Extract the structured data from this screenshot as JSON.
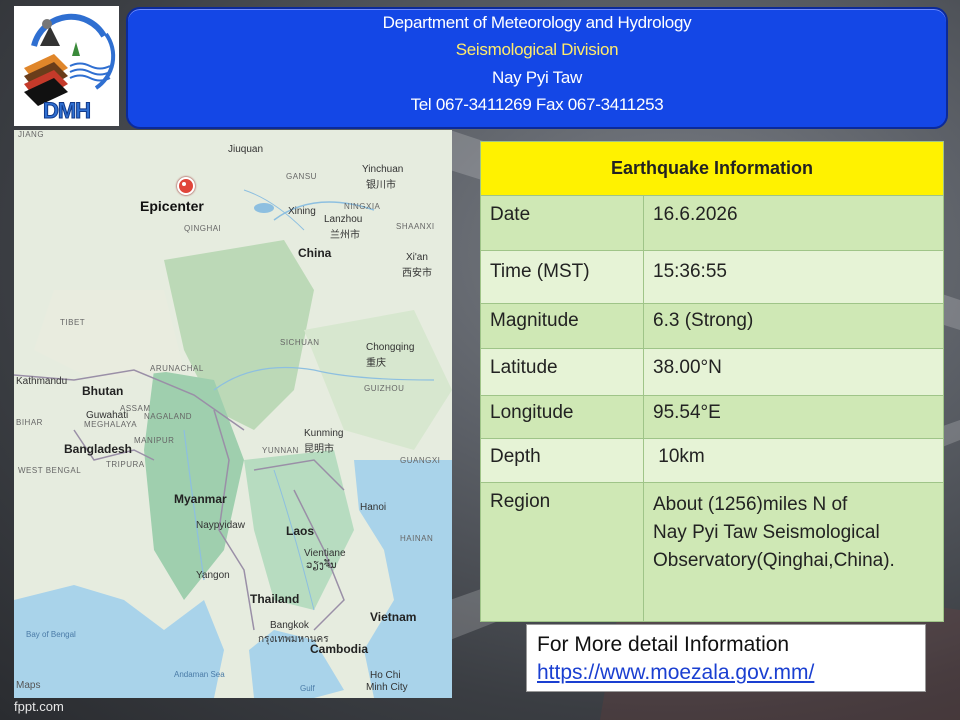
{
  "logo": {
    "text": "DMH"
  },
  "header": {
    "line1": "Department of Meteorology and Hydrology",
    "line2": "Seismological Division",
    "line3": "Nay Pyi Taw",
    "line4": "Tel 067-3411269 Fax 067-3411253"
  },
  "map": {
    "epicenter_label": "Epicenter",
    "labels": {
      "jiang": "JIANG",
      "juquan": "Jiuquan",
      "yinchuan": "Yinchuan",
      "yinchuan_cn": "银川市",
      "gansu": "GANSU",
      "ningxia": "NINGXIA",
      "xining": "Xining",
      "lanzhou": "Lanzhou",
      "lanzhou_cn": "兰州市",
      "qinghai": "QINGHAI",
      "shaanxi": "SHAANXI",
      "china": "China",
      "xian": "Xi'an",
      "xian_cn": "西安市",
      "tibet": "TIBET",
      "sichuan": "SICHUAN",
      "chongqing": "Chongqing",
      "chongqing_cn": "重庆",
      "kathmandu": "Kathmandu",
      "arunachal": "ARUNACHAL",
      "bhutan": "Bhutan",
      "guizhou": "GUIZHOU",
      "assam": "ASSAM",
      "guwahati": "Guwahati",
      "nagaland": "NAGALAND",
      "meghalaya": "MEGHALAYA",
      "bihar": "BIHAR",
      "manipur": "MANIPUR",
      "kunming": "Kunming",
      "kunming_cn": "昆明市",
      "yunnan": "YUNNAN",
      "guangxi": "GUANGXI",
      "bangladesh": "Bangladesh",
      "tripura": "TRIPURA",
      "west_bengal": "WEST BENGAL",
      "myanmar": "Myanmar",
      "hanoi": "Hanoi",
      "naypyidaw": "Naypyidaw",
      "laos": "Laos",
      "hainan": "HAINAN",
      "vientiane": "Vientiane",
      "vientiane_local": "ວຽງຈັນ",
      "yangon": "Yangon",
      "thailand": "Thailand",
      "bay_of_bengal": "Bay of Bengal",
      "vietnam": "Vietnam",
      "bangkok": "Bangkok",
      "bangkok_th": "กรุงเทพมหานคร",
      "cambodia": "Cambodia",
      "andaman": "Andaman Sea",
      "gulf": "Gulf",
      "ho_chi_minh": "Ho Chi",
      "ho_chi_minh2": "Minh City",
      "maps": "Maps"
    }
  },
  "info": {
    "title": "Earthquake Information",
    "rows": [
      {
        "label": "Date",
        "value": "16.6.2026"
      },
      {
        "label": "Time (MST)",
        "value": "15:36:55"
      },
      {
        "label": "Magnitude",
        "value": "6.3 (Strong)"
      },
      {
        "label": "Latitude",
        "value": "38.00°N"
      },
      {
        "label": "Longitude",
        "value": "95.54°E"
      },
      {
        "label": "Depth",
        "value": " 10km"
      }
    ],
    "region_label": "Region",
    "region_lines": [
      "About (1256)miles N of",
      "Nay Pyi Taw Seismological",
      "Observatory(Qinghai,China)."
    ]
  },
  "detail": {
    "line1": "For More detail Information",
    "link": "https://www.moezala.gov.mm/"
  },
  "watermark": "fppt.com",
  "colors": {
    "header_bg": "#1447e6",
    "header_sub": "#ffeb6b",
    "table_title_bg": "#fff200",
    "table_bg": "#cfe8b5",
    "link": "#1a3fd1",
    "epicenter": "#e0453a"
  }
}
